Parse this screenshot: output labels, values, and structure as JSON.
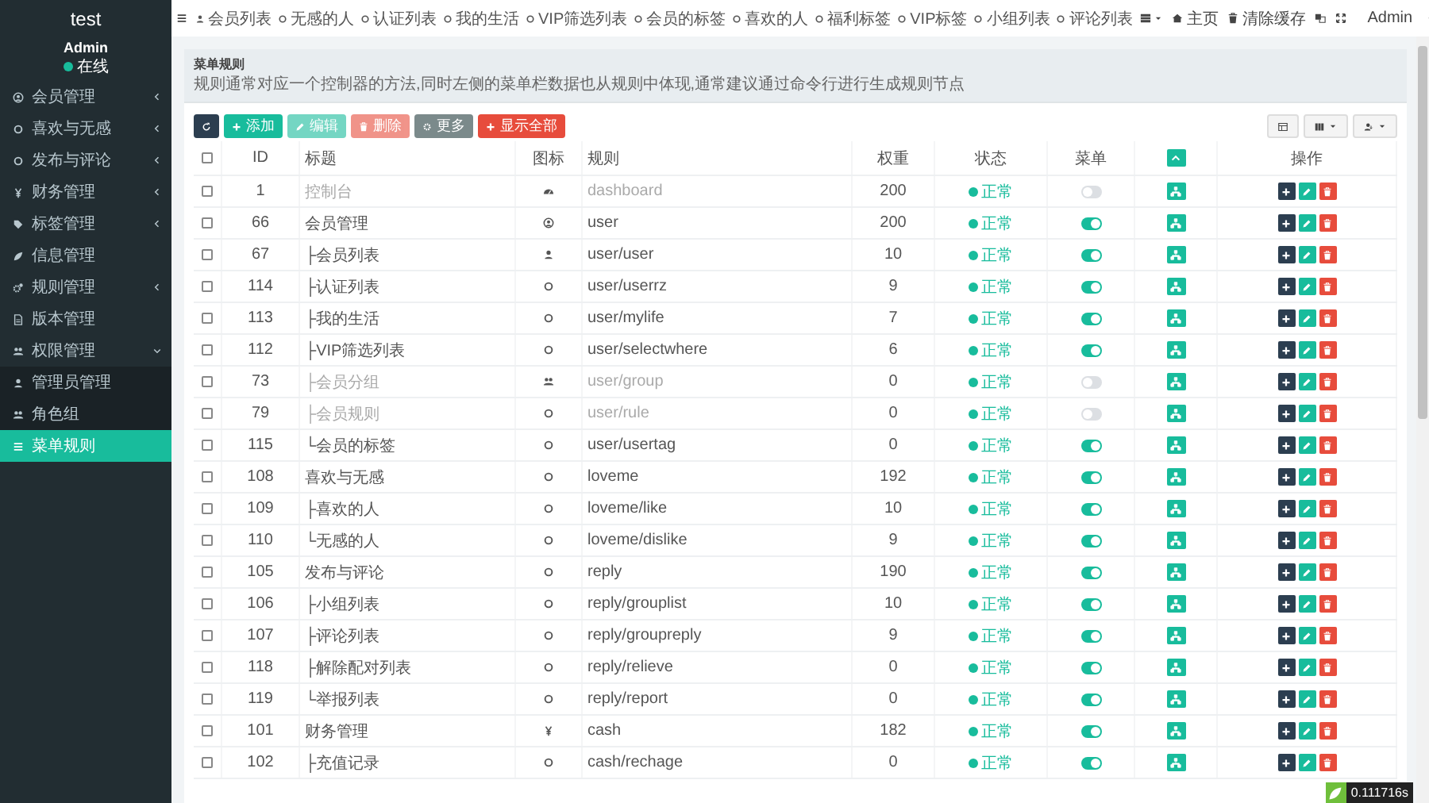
{
  "app": {
    "logo": "test"
  },
  "user": {
    "name": "Admin",
    "status": "在线"
  },
  "sidebar": {
    "items": [
      {
        "label": "会员管理",
        "kind": "user-circle",
        "expanded": false,
        "selected": false
      },
      {
        "label": "喜欢与无感",
        "kind": "circle",
        "expanded": false,
        "selected": false
      },
      {
        "label": "发布与评论",
        "kind": "circle",
        "expanded": false,
        "selected": false
      },
      {
        "label": "财务管理",
        "kind": "yen",
        "expanded": false,
        "selected": false
      },
      {
        "label": "标签管理",
        "kind": "tag",
        "expanded": false,
        "selected": false
      },
      {
        "label": "信息管理",
        "kind": "leaf",
        "selected": false
      },
      {
        "label": "规则管理",
        "kind": "gears",
        "expanded": false,
        "selected": false
      },
      {
        "label": "版本管理",
        "kind": "file",
        "selected": false
      },
      {
        "label": "权限管理",
        "kind": "users",
        "expanded": true,
        "selected": false,
        "children": [
          {
            "label": "管理员管理",
            "kind": "user",
            "selected": false
          },
          {
            "label": "角色组",
            "kind": "users",
            "selected": false
          },
          {
            "label": "菜单规则",
            "kind": "bars",
            "selected": true
          }
        ]
      }
    ]
  },
  "tabs": [
    {
      "label": "会员列表",
      "kind": "user"
    },
    {
      "label": "无感的人",
      "kind": "circle"
    },
    {
      "label": "认证列表",
      "kind": "circle"
    },
    {
      "label": "我的生活",
      "kind": "circle"
    },
    {
      "label": "VIP筛选列表",
      "kind": "circle"
    },
    {
      "label": "会员的标签",
      "kind": "circle"
    },
    {
      "label": "喜欢的人",
      "kind": "circle"
    },
    {
      "label": "福利标签",
      "kind": "circle"
    },
    {
      "label": "VIP标签",
      "kind": "circle"
    },
    {
      "label": "小组列表",
      "kind": "circle"
    },
    {
      "label": "评论列表",
      "kind": "circle"
    }
  ],
  "topbar_right": {
    "home": "主页",
    "clear_cache": "清除缓存",
    "user": "Admin"
  },
  "page_header": {
    "title": "菜单规则",
    "description": "规则通常对应一个控制器的方法,同时左侧的菜单栏数据也从规则中体现,通常建议通过命令行进行生成规则节点"
  },
  "toolbar": {
    "buttons": [
      {
        "kind": "refresh",
        "disabled": false
      },
      {
        "kind": "add",
        "label": "添加",
        "disabled": false
      },
      {
        "kind": "edit",
        "label": "编辑",
        "disabled": true
      },
      {
        "kind": "delete",
        "label": "删除",
        "disabled": true
      },
      {
        "kind": "more",
        "label": "更多",
        "disabled": false
      },
      {
        "kind": "expand",
        "label": "显示全部",
        "disabled": false
      }
    ]
  },
  "table": {
    "header_checkbox": {
      "checked": false
    },
    "columns": [
      {
        "kind": "checkbox"
      },
      {
        "kind": "text",
        "label": "ID"
      },
      {
        "kind": "text",
        "label": "标题"
      },
      {
        "kind": "text",
        "label": "图标"
      },
      {
        "kind": "text",
        "label": "规则"
      },
      {
        "kind": "text",
        "label": "权重"
      },
      {
        "kind": "text",
        "label": "状态"
      },
      {
        "kind": "text",
        "label": "菜单"
      },
      {
        "kind": "collapse"
      },
      {
        "kind": "text",
        "label": "操作"
      }
    ],
    "rows": [
      {
        "id": "1",
        "title": "控制台",
        "kind": "dashboard",
        "rule": "dashboard",
        "weight": "200",
        "status": "正常",
        "menu": false,
        "checked": false
      },
      {
        "id": "66",
        "title": "会员管理",
        "kind": "user-circle",
        "rule": "user",
        "weight": "200",
        "status": "正常",
        "menu": true,
        "checked": false,
        "children": [
          {
            "id": "67",
            "title": "├会员列表",
            "kind": "user",
            "rule": "user/user",
            "weight": "10",
            "status": "正常",
            "menu": true,
            "checked": false
          },
          {
            "id": "114",
            "title": "├认证列表",
            "kind": "circle",
            "rule": "user/userrz",
            "weight": "9",
            "status": "正常",
            "menu": true,
            "checked": false
          },
          {
            "id": "113",
            "title": "├我的生活",
            "kind": "circle",
            "rule": "user/mylife",
            "weight": "7",
            "status": "正常",
            "menu": true,
            "checked": false
          },
          {
            "id": "112",
            "title": "├VIP筛选列表",
            "kind": "circle",
            "rule": "user/selectwhere",
            "weight": "6",
            "status": "正常",
            "menu": true,
            "checked": false
          },
          {
            "id": "73",
            "title": "├会员分组",
            "kind": "users",
            "rule": "user/group",
            "weight": "0",
            "status": "正常",
            "menu": false,
            "checked": false
          },
          {
            "id": "79",
            "title": "├会员规则",
            "kind": "circle",
            "rule": "user/rule",
            "weight": "0",
            "status": "正常",
            "menu": false,
            "checked": false
          },
          {
            "id": "115",
            "title": "└会员的标签",
            "kind": "circle",
            "rule": "user/usertag",
            "weight": "0",
            "status": "正常",
            "menu": true,
            "checked": false
          }
        ]
      },
      {
        "id": "108",
        "title": "喜欢与无感",
        "kind": "circle",
        "rule": "loveme",
        "weight": "192",
        "status": "正常",
        "menu": true,
        "checked": false,
        "children": [
          {
            "id": "109",
            "title": "├喜欢的人",
            "kind": "circle",
            "rule": "loveme/like",
            "weight": "10",
            "status": "正常",
            "menu": true,
            "checked": false
          },
          {
            "id": "110",
            "title": "└无感的人",
            "kind": "circle",
            "rule": "loveme/dislike",
            "weight": "9",
            "status": "正常",
            "menu": true,
            "checked": false
          }
        ]
      },
      {
        "id": "105",
        "title": "发布与评论",
        "kind": "circle",
        "rule": "reply",
        "weight": "190",
        "status": "正常",
        "menu": true,
        "checked": false,
        "children": [
          {
            "id": "106",
            "title": "├小组列表",
            "kind": "circle",
            "rule": "reply/grouplist",
            "weight": "10",
            "status": "正常",
            "menu": true,
            "checked": false
          },
          {
            "id": "107",
            "title": "├评论列表",
            "kind": "circle",
            "rule": "reply/groupreply",
            "weight": "9",
            "status": "正常",
            "menu": true,
            "checked": false
          },
          {
            "id": "118",
            "title": "├解除配对列表",
            "kind": "circle",
            "rule": "reply/relieve",
            "weight": "0",
            "status": "正常",
            "menu": true,
            "checked": false
          },
          {
            "id": "119",
            "title": "└举报列表",
            "kind": "circle",
            "rule": "reply/report",
            "weight": "0",
            "status": "正常",
            "menu": true,
            "checked": false
          }
        ]
      },
      {
        "id": "101",
        "title": "财务管理",
        "kind": "yen",
        "rule": "cash",
        "weight": "182",
        "status": "正常",
        "menu": true,
        "checked": false,
        "children": [
          {
            "id": "102",
            "title": "├充值记录",
            "kind": "circle",
            "rule": "cash/rechage",
            "weight": "0",
            "status": "正常",
            "menu": true,
            "checked": false
          }
        ]
      }
    ]
  },
  "debug": {
    "time": "0.111716s"
  }
}
